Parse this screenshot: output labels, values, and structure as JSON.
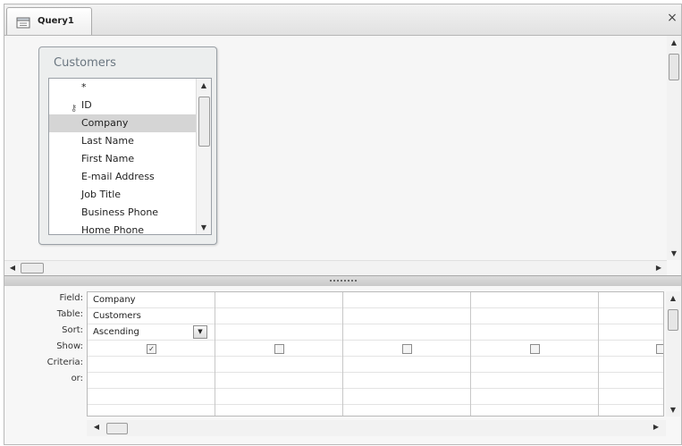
{
  "tab": {
    "title": "Query1",
    "close_glyph": "×",
    "icon": "query-icon"
  },
  "table_box": {
    "title": "Customers",
    "fields": [
      "*",
      "ID",
      "Company",
      "Last Name",
      "First Name",
      "E-mail Address",
      "Job Title",
      "Business Phone",
      "Home Phone"
    ],
    "selected_field": "Company",
    "primary_key_field": "ID"
  },
  "grid": {
    "row_labels": {
      "field": "Field:",
      "table": "Table:",
      "sort": "Sort:",
      "show": "Show:",
      "criteria": "Criteria:",
      "or": "or:"
    },
    "columns": [
      {
        "field": "Company",
        "table": "Customers",
        "sort": "Ascending",
        "show": true
      },
      {
        "field": "",
        "table": "",
        "sort": "",
        "show": false
      },
      {
        "field": "",
        "table": "",
        "sort": "",
        "show": false
      },
      {
        "field": "",
        "table": "",
        "sort": "",
        "show": false
      },
      {
        "field": "",
        "table": "",
        "sort": "",
        "show": false
      }
    ],
    "check_glyph": "✓"
  },
  "glyphs": {
    "up": "▲",
    "down": "▼",
    "left": "◀",
    "right": "▶",
    "dropdown": "▼"
  }
}
